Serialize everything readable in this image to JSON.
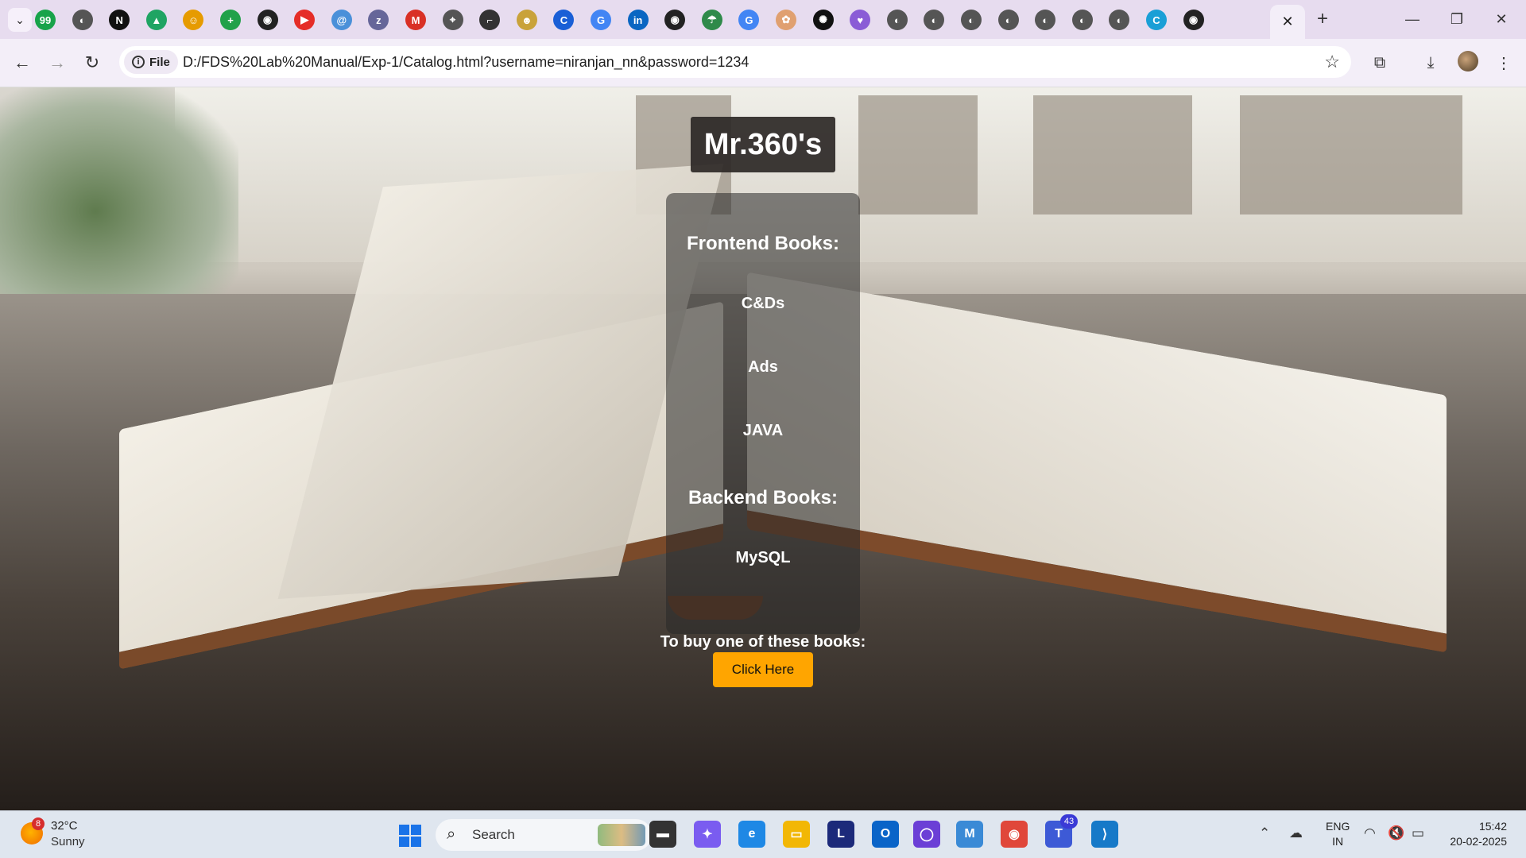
{
  "browser": {
    "tabs": [
      {
        "icon": "tab-search-icon"
      },
      {
        "icon": "cricket-icon",
        "color": "#18a34a",
        "glyph": "99"
      },
      {
        "icon": "globe-icon",
        "color": "#555555",
        "glyph": "◐"
      },
      {
        "icon": "notion-icon",
        "color": "#111111",
        "glyph": "N"
      },
      {
        "icon": "google-drive-icon",
        "color": "#1fa463",
        "glyph": "▲"
      },
      {
        "icon": "emoji-icon",
        "color": "#e69b00",
        "glyph": "☺"
      },
      {
        "icon": "plus-circle-icon",
        "color": "#21a14a",
        "glyph": "+"
      },
      {
        "icon": "github-icon",
        "color": "#222222",
        "glyph": "◉"
      },
      {
        "icon": "youtube-icon",
        "color": "#e52d27",
        "glyph": "▶"
      },
      {
        "icon": "spiral-icon",
        "color": "#4a90d9",
        "glyph": "@"
      },
      {
        "icon": "zeo-icon",
        "color": "#666699",
        "glyph": "z"
      },
      {
        "icon": "gmail-icon",
        "color": "#d93025",
        "glyph": "M"
      },
      {
        "icon": "compass-icon",
        "color": "#555555",
        "glyph": "⌖"
      },
      {
        "icon": "bookmark-icon",
        "color": "#333333",
        "glyph": "⌐"
      },
      {
        "icon": "character-icon",
        "color": "#c9a23a",
        "glyph": "☻"
      },
      {
        "icon": "c-icon",
        "color": "#1a5fd6",
        "glyph": "C"
      },
      {
        "icon": "google-icon",
        "color": "#4285f4",
        "glyph": "G"
      },
      {
        "icon": "linkedin-icon",
        "color": "#0a66c2",
        "glyph": "in"
      },
      {
        "icon": "github-icon",
        "color": "#222222",
        "glyph": "◉"
      },
      {
        "icon": "umbrella-icon",
        "color": "#2f8a4a",
        "glyph": "☂"
      },
      {
        "icon": "google-icon",
        "color": "#4285f4",
        "glyph": "G"
      },
      {
        "icon": "flower-icon",
        "color": "#e0a070",
        "glyph": "✿"
      },
      {
        "icon": "openai-icon",
        "color": "#111111",
        "glyph": "✺"
      },
      {
        "icon": "heart-shield-icon",
        "color": "#8a5cd6",
        "glyph": "♥"
      },
      {
        "icon": "globe-icon",
        "color": "#555555",
        "glyph": "◐"
      },
      {
        "icon": "globe-icon",
        "color": "#555555",
        "glyph": "◐"
      },
      {
        "icon": "globe-icon",
        "color": "#555555",
        "glyph": "◐"
      },
      {
        "icon": "globe-icon",
        "color": "#555555",
        "glyph": "◐"
      },
      {
        "icon": "globe-icon",
        "color": "#555555",
        "glyph": "◐"
      },
      {
        "icon": "globe-icon",
        "color": "#555555",
        "glyph": "◐"
      },
      {
        "icon": "globe-icon",
        "color": "#555555",
        "glyph": "◐"
      },
      {
        "icon": "edge-c-icon",
        "color": "#1a9fd6",
        "glyph": "C"
      },
      {
        "icon": "github-icon",
        "color": "#222222",
        "glyph": "◉"
      }
    ],
    "active_tab_close": "✕",
    "new_tab": "+",
    "window_controls": {
      "minimize": "—",
      "restore": "❐",
      "close": "✕"
    },
    "site_chip_label": "File",
    "url": "D:/FDS%20Lab%20Manual/Exp-1/Catalog.html?username=niranjan_nn&password=1234"
  },
  "page": {
    "brand": "Mr.360's",
    "sections": [
      {
        "heading": "Frontend Books:",
        "items": [
          "C&Ds",
          "Ads",
          "JAVA"
        ]
      },
      {
        "heading": "Backend Books:",
        "items": [
          "MySQL"
        ]
      }
    ],
    "buy_text": "To buy one of these books:",
    "buy_button": "Click Here",
    "accent": "#ffa500"
  },
  "taskbar": {
    "weather": {
      "badge": "8",
      "temp": "32°C",
      "condition": "Sunny"
    },
    "search_label": "Search",
    "apps": [
      {
        "icon": "file-explorer-dark-icon",
        "color": "#333333",
        "glyph": "▬"
      },
      {
        "icon": "copilot-icon",
        "color": "#7a5cf0",
        "glyph": "✦"
      },
      {
        "icon": "edge-icon",
        "color": "#1e88e5",
        "glyph": "e"
      },
      {
        "icon": "file-explorer-icon",
        "color": "#f2b705",
        "glyph": "▭"
      },
      {
        "icon": "l-app-icon",
        "color": "#1c2a7a",
        "glyph": "L"
      },
      {
        "icon": "outlook-icon",
        "color": "#0a64c8",
        "glyph": "O"
      },
      {
        "icon": "circle-app-icon",
        "color": "#6b3fd6",
        "glyph": "◯"
      },
      {
        "icon": "m365-icon",
        "color": "#3a8ad6",
        "glyph": "M"
      },
      {
        "icon": "chrome-icon",
        "color": "#e0473a",
        "glyph": "◉"
      },
      {
        "icon": "teams-icon",
        "color": "#3d5ad6",
        "glyph": "T",
        "badge": "43"
      },
      {
        "icon": "vscode-icon",
        "color": "#1679c8",
        "glyph": "⟩"
      }
    ],
    "language": {
      "line1": "ENG",
      "line2": "IN"
    },
    "time": "15:42",
    "date": "20-02-2025"
  }
}
